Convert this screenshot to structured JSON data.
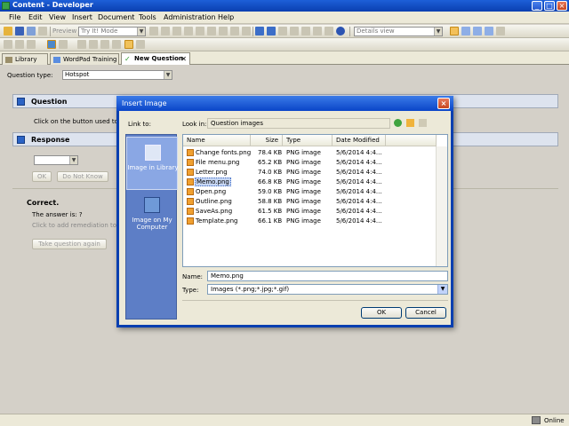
{
  "window": {
    "title": "Content - Developer"
  },
  "menubar": {
    "items": [
      "File",
      "Edit",
      "View",
      "Insert",
      "Document",
      "Tools",
      "Administration",
      "Help"
    ]
  },
  "toolbar": {
    "preview_label": "Preview",
    "mode_combo": "Try It! Mode",
    "view_combo": "Details view"
  },
  "tabs": [
    {
      "label": "Library"
    },
    {
      "label": "WordPad Training"
    },
    {
      "label": "New Question"
    }
  ],
  "content": {
    "question_type_label": "Question type:",
    "question_type_value": "Hotspot",
    "question_header": "Question",
    "question_text": "Click on the button used to",
    "response_header": "Response",
    "ok_label": "OK",
    "do_not_know_label": "Do Not Know",
    "correct_label": "Correct.",
    "answer_text": "The answer is: ?",
    "remediation_text": "Click to add remediation to",
    "take_again_label": "Take question again"
  },
  "dialog": {
    "title": "Insert Image",
    "link_to_label": "Link to:",
    "look_in_label": "Look in:",
    "look_in_value": "Question images",
    "places": [
      {
        "label": "Image in Library"
      },
      {
        "label": "Image on My Computer"
      }
    ],
    "columns": [
      "Name",
      "Size",
      "Type",
      "Date Modified"
    ],
    "files": [
      {
        "name": "Change fonts.png",
        "size": "78.4 KB",
        "type": "PNG image",
        "date": "5/6/2014 4:4..."
      },
      {
        "name": "File menu.png",
        "size": "65.2 KB",
        "type": "PNG image",
        "date": "5/6/2014 4:4..."
      },
      {
        "name": "Letter.png",
        "size": "74.0 KB",
        "type": "PNG image",
        "date": "5/6/2014 4:4..."
      },
      {
        "name": "Memo.png",
        "size": "66.8 KB",
        "type": "PNG image",
        "date": "5/6/2014 4:4..."
      },
      {
        "name": "Open.png",
        "size": "59.0 KB",
        "type": "PNG image",
        "date": "5/6/2014 4:4..."
      },
      {
        "name": "Outline.png",
        "size": "58.8 KB",
        "type": "PNG image",
        "date": "5/6/2014 4:4..."
      },
      {
        "name": "SaveAs.png",
        "size": "61.5 KB",
        "type": "PNG image",
        "date": "5/6/2014 4:4..."
      },
      {
        "name": "Template.png",
        "size": "66.1 KB",
        "type": "PNG image",
        "date": "5/6/2014 4:4..."
      }
    ],
    "selected_file": "Memo.png",
    "name_label": "Name:",
    "name_value": "Memo.png",
    "type_label": "Type:",
    "type_value": "Images (*.png;*.jpg;*.gif)",
    "ok_label": "OK",
    "cancel_label": "Cancel"
  },
  "statusbar": {
    "status": "Online"
  },
  "colors": {
    "titlebar": "#0a3fb0",
    "dialog_places": "#5d7ec6",
    "selection": "#c7d7f4"
  }
}
